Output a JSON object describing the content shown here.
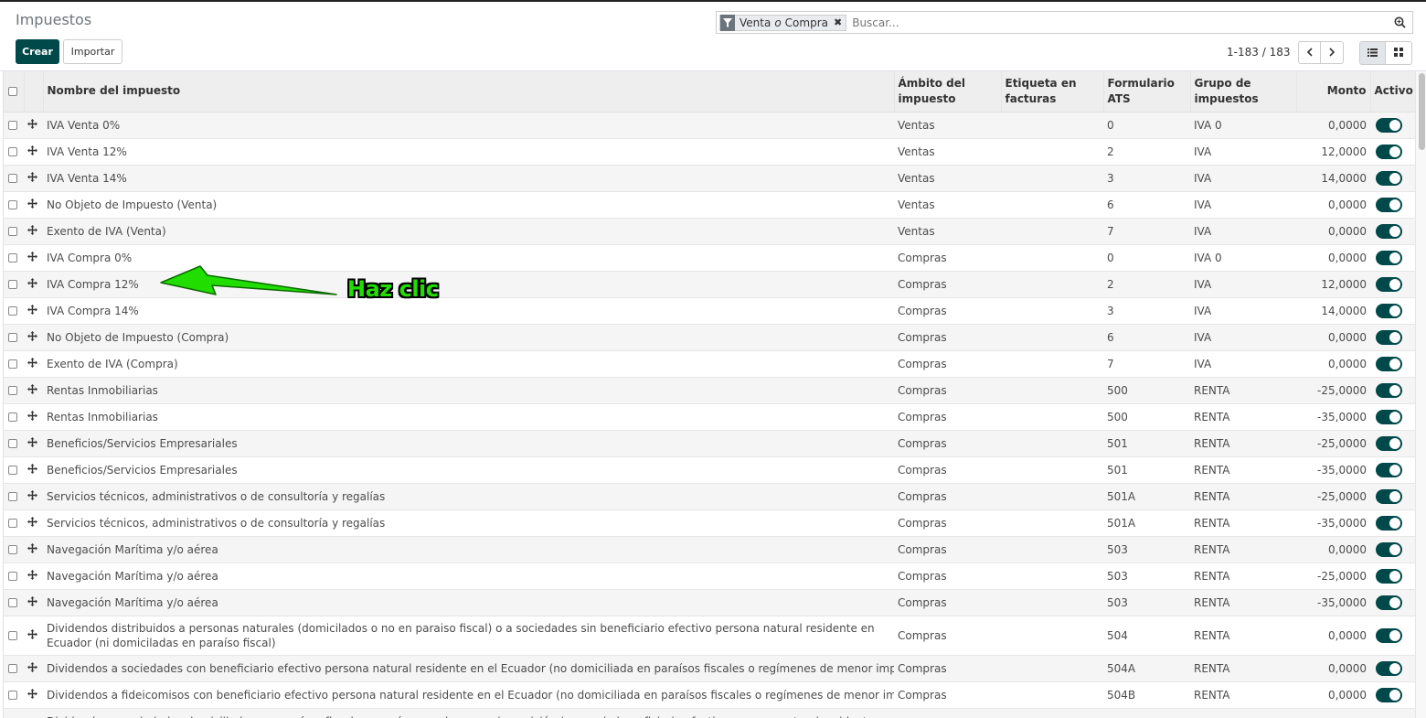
{
  "page": {
    "title": "Impuestos",
    "create_label": "Crear",
    "import_label": "Importar"
  },
  "search": {
    "facet_value_1": "Venta",
    "facet_separator": "o",
    "facet_value_2": "Compra",
    "placeholder": "Buscar..."
  },
  "pager": {
    "range": "1-183",
    "separator": "/",
    "total": "183"
  },
  "columns": {
    "name": "Nombre del impuesto",
    "scope": "Ámbito del impuesto",
    "invoice_label": "Etiqueta en facturas",
    "ats_form": "Formulario ATS",
    "tax_group": "Grupo de impuestos",
    "amount": "Monto",
    "active": "Activo"
  },
  "rows": [
    {
      "name": "IVA Venta 0%",
      "scope": "Ventas",
      "label": "",
      "ats": "0",
      "group": "IVA 0",
      "amount": "0,0000"
    },
    {
      "name": "IVA Venta 12%",
      "scope": "Ventas",
      "label": "",
      "ats": "2",
      "group": "IVA",
      "amount": "12,0000"
    },
    {
      "name": "IVA Venta 14%",
      "scope": "Ventas",
      "label": "",
      "ats": "3",
      "group": "IVA",
      "amount": "14,0000"
    },
    {
      "name": "No Objeto de Impuesto (Venta)",
      "scope": "Ventas",
      "label": "",
      "ats": "6",
      "group": "IVA",
      "amount": "0,0000"
    },
    {
      "name": "Exento de IVA (Venta)",
      "scope": "Ventas",
      "label": "",
      "ats": "7",
      "group": "IVA",
      "amount": "0,0000"
    },
    {
      "name": "IVA Compra 0%",
      "scope": "Compras",
      "label": "",
      "ats": "0",
      "group": "IVA 0",
      "amount": "0,0000"
    },
    {
      "name": "IVA Compra 12%",
      "scope": "Compras",
      "label": "",
      "ats": "2",
      "group": "IVA",
      "amount": "12,0000"
    },
    {
      "name": "IVA Compra 14%",
      "scope": "Compras",
      "label": "",
      "ats": "3",
      "group": "IVA",
      "amount": "14,0000"
    },
    {
      "name": "No Objeto de Impuesto (Compra)",
      "scope": "Compras",
      "label": "",
      "ats": "6",
      "group": "IVA",
      "amount": "0,0000"
    },
    {
      "name": "Exento de IVA (Compra)",
      "scope": "Compras",
      "label": "",
      "ats": "7",
      "group": "IVA",
      "amount": "0,0000"
    },
    {
      "name": "Rentas Inmobiliarias",
      "scope": "Compras",
      "label": "",
      "ats": "500",
      "group": "RENTA",
      "amount": "-25,0000"
    },
    {
      "name": "Rentas Inmobiliarias",
      "scope": "Compras",
      "label": "",
      "ats": "500",
      "group": "RENTA",
      "amount": "-35,0000"
    },
    {
      "name": "Beneficios/Servicios Empresariales",
      "scope": "Compras",
      "label": "",
      "ats": "501",
      "group": "RENTA",
      "amount": "-25,0000"
    },
    {
      "name": "Beneficios/Servicios Empresariales",
      "scope": "Compras",
      "label": "",
      "ats": "501",
      "group": "RENTA",
      "amount": "-35,0000"
    },
    {
      "name": "Servicios técnicos, administrativos o de consultoría y regalías",
      "scope": "Compras",
      "label": "",
      "ats": "501A",
      "group": "RENTA",
      "amount": "-25,0000"
    },
    {
      "name": "Servicios técnicos, administrativos o de consultoría y regalías",
      "scope": "Compras",
      "label": "",
      "ats": "501A",
      "group": "RENTA",
      "amount": "-35,0000"
    },
    {
      "name": "Navegación Marítima y/o aérea",
      "scope": "Compras",
      "label": "",
      "ats": "503",
      "group": "RENTA",
      "amount": "0,0000"
    },
    {
      "name": "Navegación Marítima y/o aérea",
      "scope": "Compras",
      "label": "",
      "ats": "503",
      "group": "RENTA",
      "amount": "-25,0000"
    },
    {
      "name": "Navegación Marítima y/o aérea",
      "scope": "Compras",
      "label": "",
      "ats": "503",
      "group": "RENTA",
      "amount": "-35,0000"
    },
    {
      "name": "Dividendos distribuidos a personas naturales (domicilados o no en paraiso fiscal) o a sociedades sin beneficiario efectivo persona natural residente en Ecuador (ni domiciladas en paraíso fiscal)",
      "scope": "Compras",
      "label": "",
      "ats": "504",
      "group": "RENTA",
      "amount": "0,0000"
    },
    {
      "name": "Dividendos a sociedades con beneficiario efectivo persona natural residente en el Ecuador (no domiciliada en paraísos fiscales o regímenes de menor imposición)",
      "scope": "Compras",
      "label": "",
      "ats": "504A",
      "group": "RENTA",
      "amount": "0,0000"
    },
    {
      "name": "Dividendos a fideicomisos con beneficiario efectivo persona natural residente en el Ecuador (no domiciliada en paraísos fiscales o regímenes de menor imposición)",
      "scope": "Compras",
      "label": "",
      "ats": "504B",
      "group": "RENTA",
      "amount": "0,0000"
    },
    {
      "name": "Dividendos a sociedades domiciliadas en paraísos fiscales o regímenes de menor imposición (con o sin beneficiario efectivo persona natural residente en el",
      "scope": "",
      "label": "",
      "ats": "",
      "group": "",
      "amount": ""
    }
  ],
  "annotation": {
    "text": "Haz clic",
    "color": "#22dd00"
  },
  "colors": {
    "primary": "#00494a"
  }
}
